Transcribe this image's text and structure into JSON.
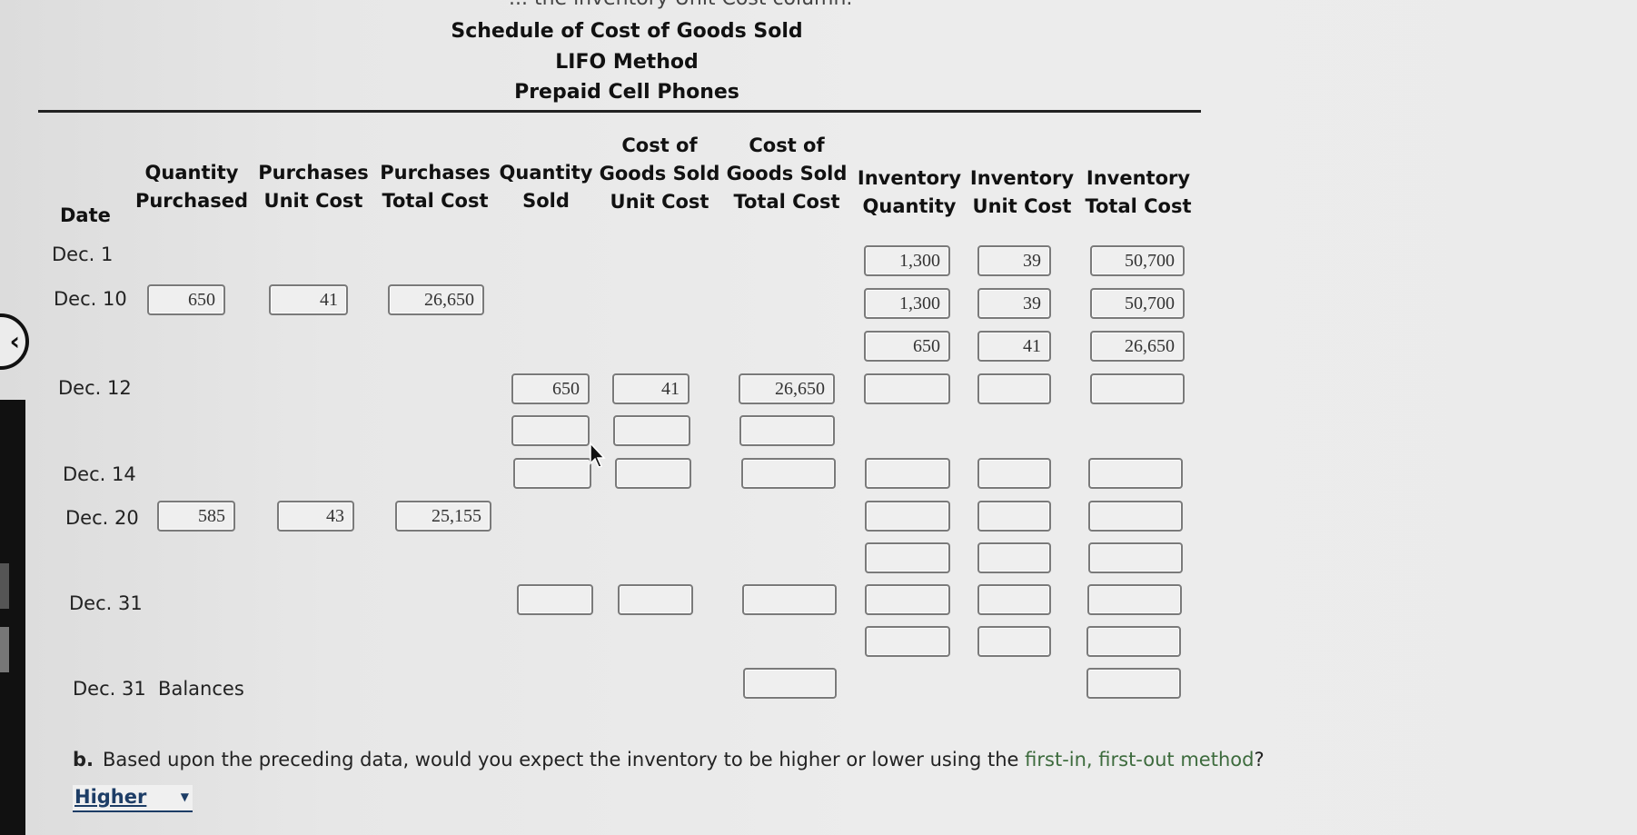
{
  "cutoff_text": "... the inventory Unit Cost column.",
  "title": {
    "line1": "Schedule of Cost of Goods Sold",
    "line2": "LIFO Method",
    "line3": "Prepaid Cell Phones"
  },
  "columns": {
    "date": "Date",
    "qty_purchased": [
      "Quantity",
      "Purchased"
    ],
    "purch_unit_cost": [
      "Purchases",
      "Unit Cost"
    ],
    "purch_total_cost": [
      "Purchases",
      "Total Cost"
    ],
    "qty_sold": [
      "Quantity",
      "Sold"
    ],
    "cogs_unit_cost": [
      "Cost of",
      "Goods Sold",
      "Unit Cost"
    ],
    "cogs_total_cost": [
      "Cost of",
      "Goods Sold",
      "Total Cost"
    ],
    "inv_qty": [
      "Inventory",
      "Quantity"
    ],
    "inv_unit_cost": [
      "Inventory",
      "Unit Cost"
    ],
    "inv_total_cost": [
      "Inventory",
      "Total Cost"
    ]
  },
  "dates": {
    "dec1": "Dec. 1",
    "dec10": "Dec. 10",
    "dec12": "Dec. 12",
    "dec14": "Dec. 14",
    "dec20": "Dec. 20",
    "dec31": "Dec. 31",
    "balances": "Dec. 31  Balances"
  },
  "rows": {
    "dec1": {
      "inv_qty": "1,300",
      "inv_unit_cost": "39",
      "inv_total_cost": "50,700"
    },
    "dec10": {
      "qty_purchased": "650",
      "purch_unit_cost": "41",
      "purch_total_cost": "26,650",
      "inv_qty": "1,300",
      "inv_unit_cost": "39",
      "inv_total_cost": "50,700"
    },
    "dec10_b": {
      "inv_qty": "650",
      "inv_unit_cost": "41",
      "inv_total_cost": "26,650"
    },
    "dec12": {
      "qty_sold": "650",
      "cogs_unit_cost": "41",
      "cogs_total_cost": "26,650",
      "inv_qty": "",
      "inv_unit_cost": "",
      "inv_total_cost": ""
    },
    "dec12_b": {
      "qty_sold": "",
      "cogs_unit_cost": "",
      "cogs_total_cost": ""
    },
    "dec14": {
      "qty_sold": "",
      "cogs_unit_cost": "",
      "cogs_total_cost": "",
      "inv_qty": "",
      "inv_unit_cost": "",
      "inv_total_cost": ""
    },
    "dec20": {
      "qty_purchased": "585",
      "purch_unit_cost": "43",
      "purch_total_cost": "25,155",
      "inv_qty": "",
      "inv_unit_cost": "",
      "inv_total_cost": ""
    },
    "dec20_b": {
      "inv_qty": "",
      "inv_unit_cost": "",
      "inv_total_cost": ""
    },
    "dec31": {
      "qty_sold": "",
      "cogs_unit_cost": "",
      "cogs_total_cost": "",
      "inv_qty": "",
      "inv_unit_cost": "",
      "inv_total_cost": ""
    },
    "dec31_b": {
      "inv_qty": "",
      "inv_unit_cost": "",
      "inv_total_cost": ""
    },
    "balances": {
      "cogs_total_cost": "",
      "inv_total_cost": ""
    }
  },
  "question_b": {
    "label": "b.",
    "text_before": "Based upon the preceding data, would you expect the inventory to be higher or lower using the ",
    "link_text": "first-in, first-out method",
    "text_after": "?",
    "selected": "Higher"
  },
  "icons": {
    "prev": "chevron-left-icon",
    "dropdown_caret": "caret-down-icon"
  }
}
